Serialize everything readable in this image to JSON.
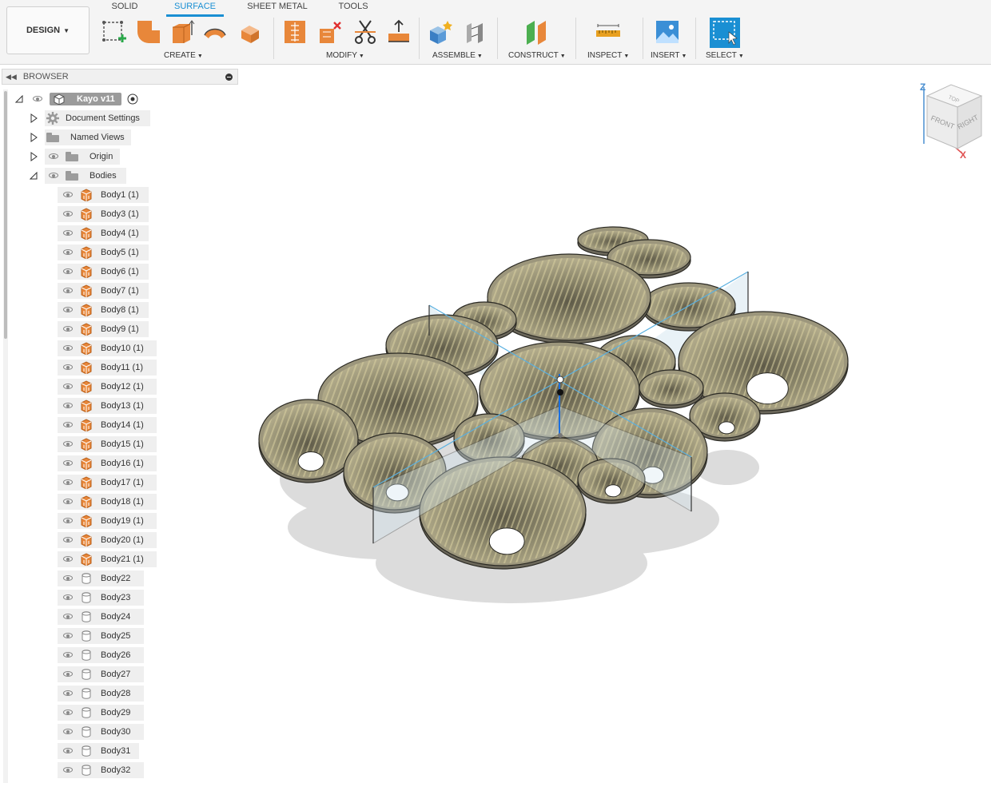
{
  "toolbar": {
    "workspace": "DESIGN",
    "tabs": [
      "SOLID",
      "SURFACE",
      "SHEET METAL",
      "TOOLS"
    ],
    "active_tab": "SURFACE",
    "groups": [
      "CREATE",
      "MODIFY",
      "ASSEMBLE",
      "CONSTRUCT",
      "INSPECT",
      "INSERT",
      "SELECT"
    ]
  },
  "browser": {
    "title": "BROWSER",
    "root": "Kayo v11",
    "document_settings": "Document Settings",
    "named_views": "Named Views",
    "origin": "Origin",
    "bodies_folder": "Bodies",
    "bodies": [
      "Body1 (1)",
      "Body3 (1)",
      "Body4 (1)",
      "Body5 (1)",
      "Body6 (1)",
      "Body7 (1)",
      "Body8 (1)",
      "Body9 (1)",
      "Body10 (1)",
      "Body11 (1)",
      "Body12 (1)",
      "Body13 (1)",
      "Body14 (1)",
      "Body15 (1)",
      "Body16 (1)",
      "Body17 (1)",
      "Body18 (1)",
      "Body19 (1)",
      "Body20 (1)",
      "Body21 (1)",
      "Body22",
      "Body23",
      "Body24",
      "Body25",
      "Body26",
      "Body27",
      "Body28",
      "Body29",
      "Body30",
      "Body31",
      "Body32"
    ],
    "solid_body_count": 20
  },
  "viewcube": {
    "faces": [
      "TOP",
      "FRONT",
      "RIGHT"
    ],
    "axes": [
      "Z",
      "X"
    ]
  },
  "colors": {
    "accent": "#1a8fd3",
    "solid_body": "#e8873a",
    "surface_body": "#9a9a9a"
  }
}
